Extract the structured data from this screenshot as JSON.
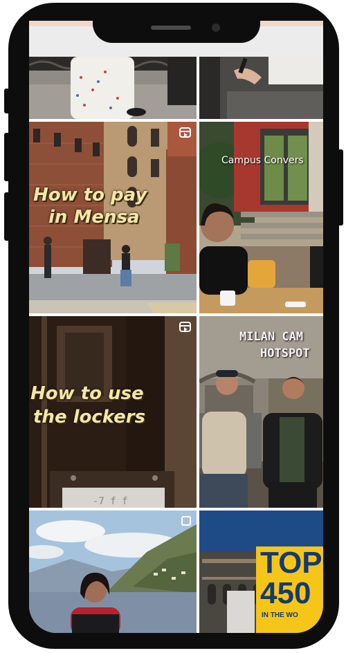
{
  "feed": {
    "tiles": [
      {
        "id": "tile-1",
        "caption": ""
      },
      {
        "id": "tile-2",
        "caption": ""
      },
      {
        "id": "tile-3",
        "caption_line1": "How to pay",
        "caption_line2": "in Mensa",
        "type_icon": "reel-icon"
      },
      {
        "id": "tile-4",
        "caption": "Campus Convers"
      },
      {
        "id": "tile-5",
        "caption_line1": "How to use",
        "caption_line2": "the lockers",
        "type_icon": "reel-icon"
      },
      {
        "id": "tile-6",
        "caption_line1": "MILAN CAM",
        "caption_line2": "HOTSPOT"
      },
      {
        "id": "tile-7",
        "caption": "",
        "type_icon": "carousel-icon"
      },
      {
        "id": "tile-8",
        "badge_line1": "TOP",
        "badge_line2": "450",
        "badge_line3": "IN THE WO"
      }
    ]
  },
  "colors": {
    "phone_frame": "#0d0d0d",
    "caption_yellow": "#f4e7a8",
    "badge_yellow": "#f5c518",
    "badge_navy": "#163a6b",
    "top_accent": "#f0d8c8"
  }
}
